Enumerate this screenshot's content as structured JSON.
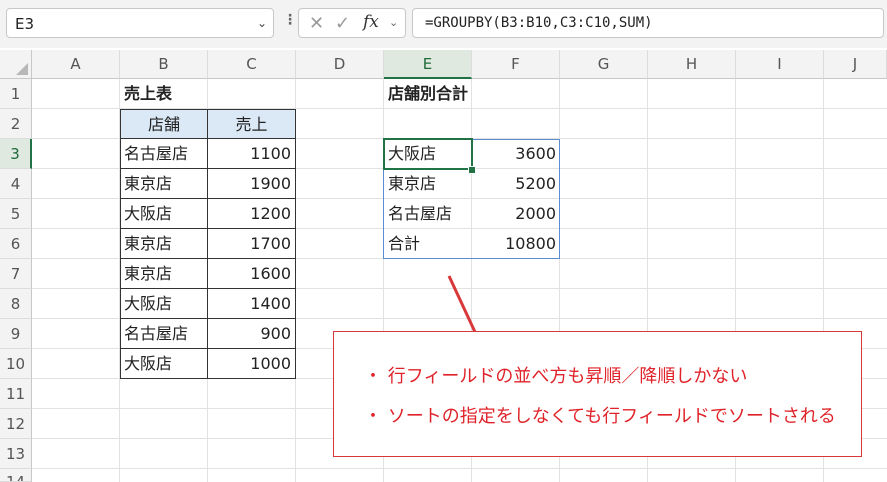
{
  "formula_bar": {
    "name_box": "E3",
    "formula": "=GROUPBY(B3:B10,C3:C10,SUM)"
  },
  "columns": [
    "A",
    "B",
    "C",
    "D",
    "E",
    "F",
    "G",
    "H",
    "I",
    "J"
  ],
  "rows": [
    "1",
    "2",
    "3",
    "4",
    "5",
    "6",
    "7",
    "8",
    "9",
    "10",
    "11",
    "12",
    "13",
    "14"
  ],
  "sales_table": {
    "title": "売上表",
    "headers": [
      "店舗",
      "売上"
    ],
    "rows": [
      [
        "名古屋店",
        "1100"
      ],
      [
        "東京店",
        "1900"
      ],
      [
        "大阪店",
        "1200"
      ],
      [
        "東京店",
        "1700"
      ],
      [
        "東京店",
        "1600"
      ],
      [
        "大阪店",
        "1400"
      ],
      [
        "名古屋店",
        "900"
      ],
      [
        "大阪店",
        "1000"
      ]
    ]
  },
  "result_table": {
    "title": "店舗別合計",
    "rows": [
      [
        "大阪店",
        "3600"
      ],
      [
        "東京店",
        "5200"
      ],
      [
        "名古屋店",
        "2000"
      ],
      [
        "合計",
        "10800"
      ]
    ]
  },
  "callout": {
    "line1": "・ 行フィールドの並べ方も昇順／降順しかない",
    "line2": "・ ソートの指定をしなくても行フィールドでソートされる"
  },
  "colors": {
    "accent_green": "#217346",
    "header_fill": "#dbe9f6",
    "callout_red": "#e0232a",
    "spill_border": "#5b8bd0"
  }
}
